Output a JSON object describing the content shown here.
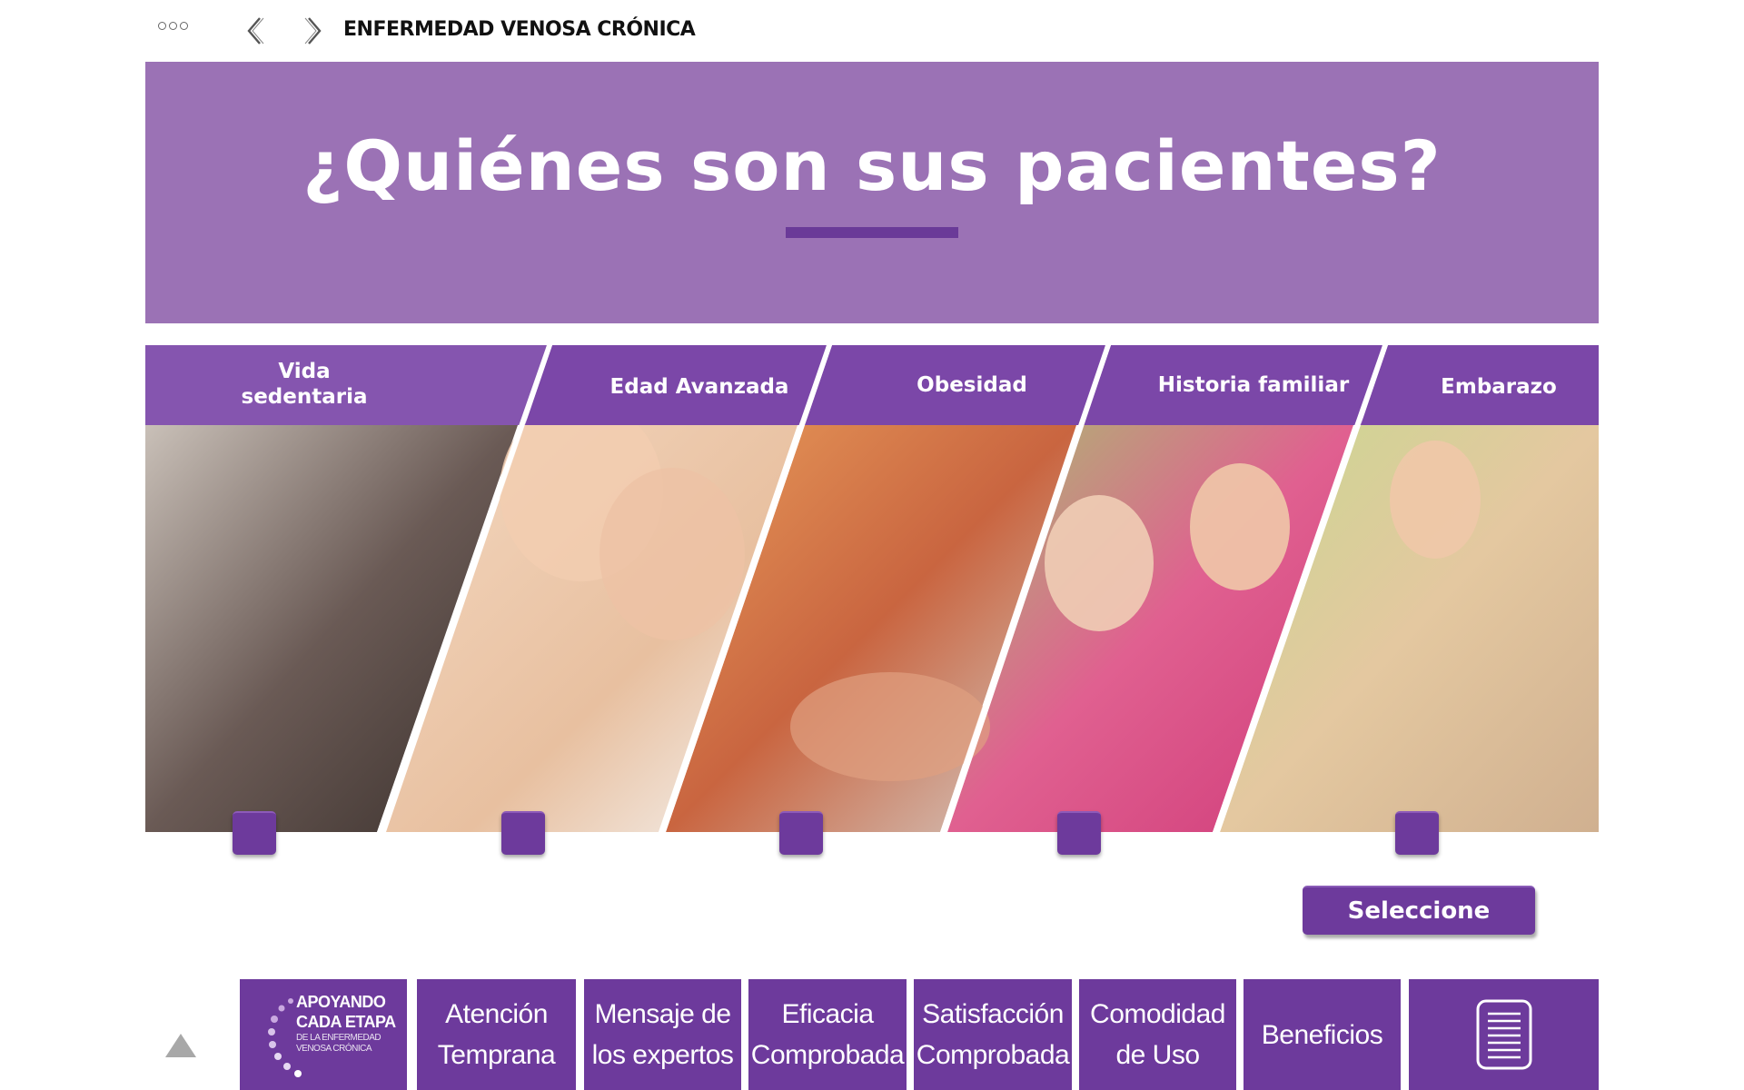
{
  "topbar": {
    "breadcrumb": "ENFERMEDAD VENOSA CRÓNICA",
    "menu_icon": "more-dots-icon",
    "back_icon": "chevron-left-icon",
    "forward_icon": "chevron-right-icon"
  },
  "banner": {
    "title": "¿Quiénes son sus pacientes?"
  },
  "panels": [
    {
      "label": "Vida\nsedentaria",
      "image": "people-legs-photo"
    },
    {
      "label": "Edad Avanzada",
      "image": "mother-daughter-photo"
    },
    {
      "label": "Obesidad",
      "image": "foot-on-scale-photo"
    },
    {
      "label": "Historia familiar",
      "image": "older-woman-and-young-woman-photo"
    },
    {
      "label": "Embarazo",
      "image": "pregnant-woman-photo"
    }
  ],
  "select_button": "Seleccione",
  "bottom_nav": {
    "up_icon": "triangle-up-icon",
    "logo": {
      "line1": "APOYANDO",
      "line2": "CADA ETAPA",
      "line3": "DE LA ENFERMEDAD",
      "line4": "VENOSA CRÓNICA"
    },
    "tiles": [
      "Atención\nTemprana",
      "Mensaje de\nlos expertos",
      "Eficacia\nComprobada",
      "Satisfacción\nComprobada",
      "Comodidad\nde Uso",
      "Beneficios"
    ],
    "doc_icon": "document-icon"
  },
  "colors": {
    "banner": "#9b72b5",
    "accent": "#6d3a9c",
    "label_band": "#7b47a8"
  }
}
